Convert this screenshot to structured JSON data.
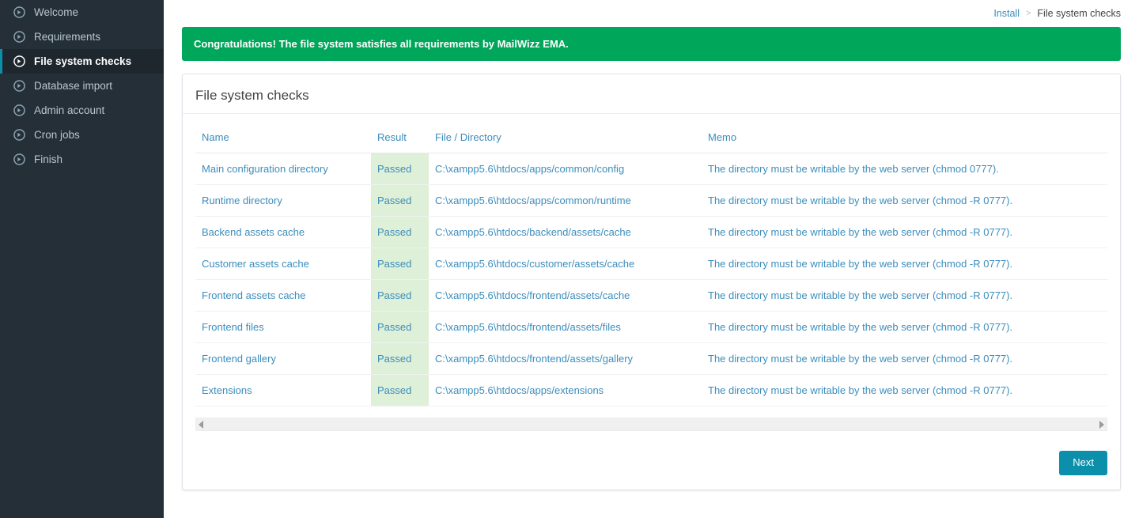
{
  "sidebar": {
    "items": [
      {
        "label": "Welcome",
        "icon": "arrow-circle-right-icon",
        "active": false
      },
      {
        "label": "Requirements",
        "icon": "arrow-circle-right-icon",
        "active": false
      },
      {
        "label": "File system checks",
        "icon": "arrow-circle-right-icon",
        "active": true
      },
      {
        "label": "Database import",
        "icon": "arrow-circle-right-icon",
        "active": false
      },
      {
        "label": "Admin account",
        "icon": "arrow-circle-right-icon",
        "active": false
      },
      {
        "label": "Cron jobs",
        "icon": "arrow-circle-right-icon",
        "active": false
      },
      {
        "label": "Finish",
        "icon": "arrow-circle-right-icon",
        "active": false
      }
    ]
  },
  "breadcrumb": {
    "root": "Install",
    "separator": ">",
    "current": "File system checks"
  },
  "alert": {
    "message": "Congratulations! The file system satisfies all requirements by MailWizz EMA."
  },
  "panel": {
    "title": "File system checks"
  },
  "table": {
    "headers": [
      "Name",
      "Result",
      "File / Directory",
      "Memo"
    ],
    "rows": [
      {
        "name": "Main configuration directory",
        "result": "Passed",
        "path": "C:\\xampp5.6\\htdocs/apps/common/config",
        "memo": "The directory must be writable by the web server (chmod 0777)."
      },
      {
        "name": "Runtime directory",
        "result": "Passed",
        "path": "C:\\xampp5.6\\htdocs/apps/common/runtime",
        "memo": "The directory must be writable by the web server (chmod -R 0777)."
      },
      {
        "name": "Backend assets cache",
        "result": "Passed",
        "path": "C:\\xampp5.6\\htdocs/backend/assets/cache",
        "memo": "The directory must be writable by the web server (chmod -R 0777)."
      },
      {
        "name": "Customer assets cache",
        "result": "Passed",
        "path": "C:\\xampp5.6\\htdocs/customer/assets/cache",
        "memo": "The directory must be writable by the web server (chmod -R 0777)."
      },
      {
        "name": "Frontend assets cache",
        "result": "Passed",
        "path": "C:\\xampp5.6\\htdocs/frontend/assets/cache",
        "memo": "The directory must be writable by the web server (chmod -R 0777)."
      },
      {
        "name": "Frontend files",
        "result": "Passed",
        "path": "C:\\xampp5.6\\htdocs/frontend/assets/files",
        "memo": "The directory must be writable by the web server (chmod -R 0777)."
      },
      {
        "name": "Frontend gallery",
        "result": "Passed",
        "path": "C:\\xampp5.6\\htdocs/frontend/assets/gallery",
        "memo": "The directory must be writable by the web server (chmod -R 0777)."
      },
      {
        "name": "Extensions",
        "result": "Passed",
        "path": "C:\\xampp5.6\\htdocs/apps/extensions",
        "memo": "The directory must be writable by the web server (chmod -R 0777)."
      }
    ]
  },
  "scrollbar": {
    "left_arrow_icon": "triangle-left-icon",
    "right_arrow_icon": "triangle-right-icon"
  },
  "footer": {
    "next_label": "Next"
  },
  "colors": {
    "sidebar_bg": "#252f37",
    "sidebar_active_border": "#0b8fab",
    "alert_green": "#00a65a",
    "link_blue": "#3c8dbc",
    "passed_cell_bg": "#dff0d8",
    "button_teal": "#0b8fab"
  }
}
